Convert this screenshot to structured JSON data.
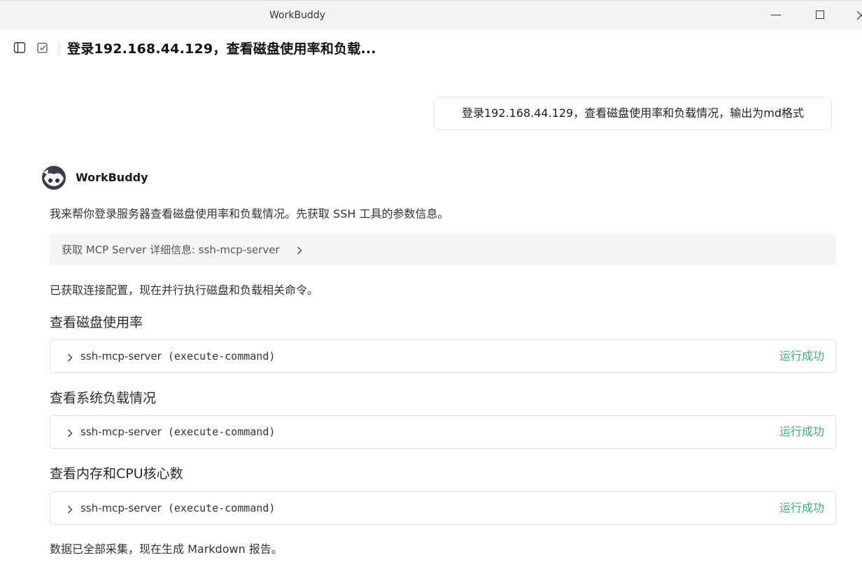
{
  "window": {
    "title": "WorkBuddy"
  },
  "header": {
    "title": "登录192.168.44.129，查看磁盘使用率和负载..."
  },
  "user_message": "登录192.168.44.129，查看磁盘使用率和负载情况，输出为md格式",
  "assistant": {
    "name": "WorkBuddy",
    "intro": "我来帮你登录服务器查看磁盘使用率和负载情况。先获取 SSH 工具的参数信息。",
    "mcp_info_label": "获取 MCP Server 详细信息: ssh-mcp-server",
    "config_text": "已获取连接配置，现在并行执行磁盘和负载相关命令。",
    "steps": [
      {
        "heading": "查看磁盘使用率",
        "tool_server": "ssh-mcp-server",
        "tool_command": "(execute-command)",
        "status": "运行成功"
      },
      {
        "heading": "查看系统负载情况",
        "tool_server": "ssh-mcp-server",
        "tool_command": "(execute-command)",
        "status": "运行成功"
      },
      {
        "heading": "查看内存和CPU核心数",
        "tool_server": "ssh-mcp-server",
        "tool_command": "(execute-command)",
        "status": "运行成功"
      }
    ],
    "final_text": "数据已全部采集，现在生成 Markdown 报告。"
  },
  "colors": {
    "success": "#3aaf7c",
    "titlebar_bg": "#f3f3f3",
    "mcp_box_bg": "#f5f5f5"
  },
  "icons": [
    "sidebar-toggle-icon",
    "edit-checkbox-icon",
    "chevron-right-icon",
    "minimize-icon",
    "maximize-icon",
    "close-icon"
  ]
}
